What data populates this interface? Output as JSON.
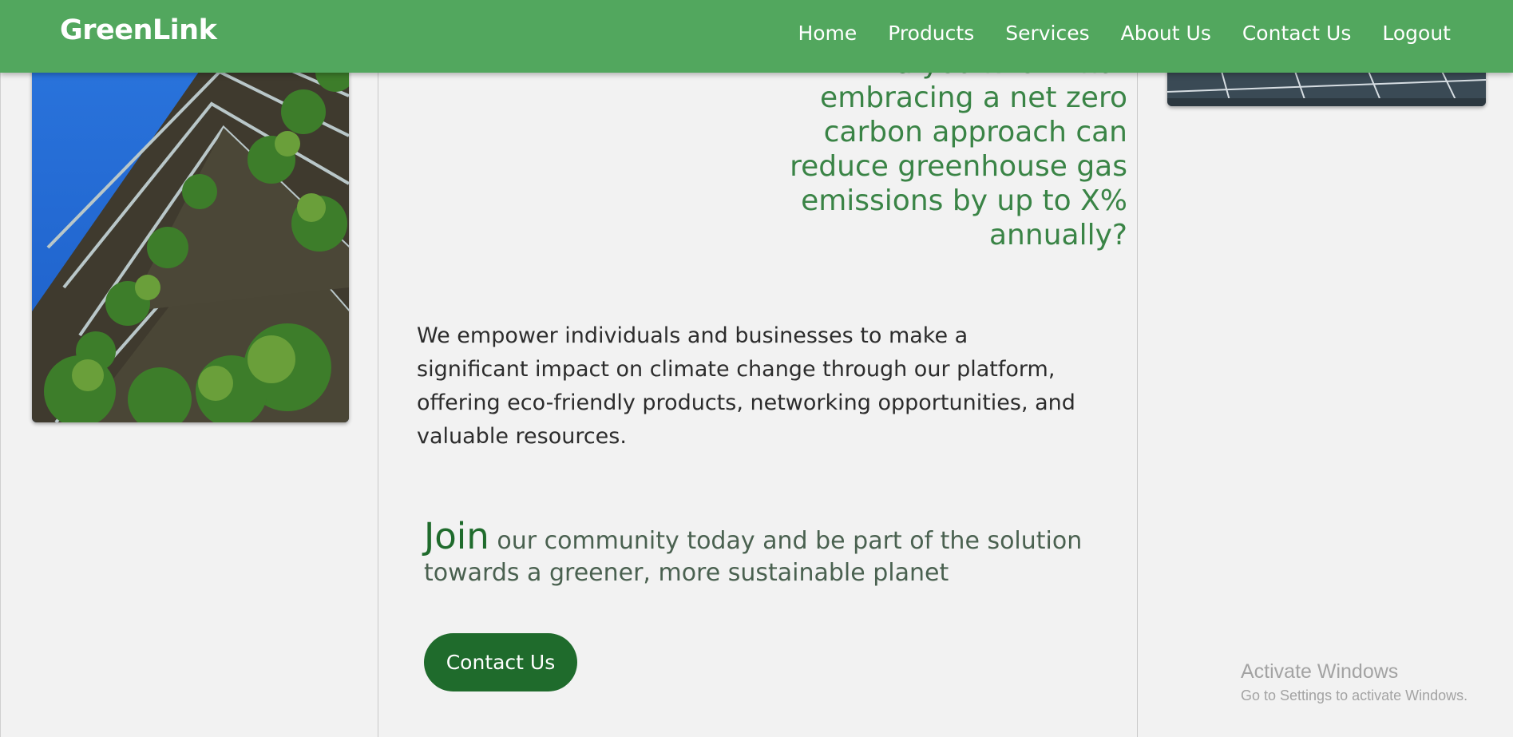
{
  "brand": "GreenLink",
  "nav": [
    "Home",
    "Products",
    "Services",
    "About Us",
    "Contact Us",
    "Logout"
  ],
  "fact_lines": [
    "Did you know that",
    "embracing a net zero",
    "carbon approach can",
    "reduce greenhouse gas",
    "emissions by up to X%",
    "annually?"
  ],
  "mission_lines": [
    "We empower individuals and businesses to make a",
    "significant impact on climate change through our platform,",
    "offering eco-friendly products, networking opportunities, and",
    "valuable resources."
  ],
  "join": {
    "highlight": "Join",
    "line1_rest": " our community today and be part of the solution",
    "line2": "towards a greener, more sustainable planet"
  },
  "cta_label": "Contact Us",
  "watermark": {
    "title": "Activate Windows",
    "subtitle": "Go to Settings to activate Windows."
  },
  "colors": {
    "navbar": "#52a75e",
    "accent_dark": "#1f6b2c",
    "fact_text": "#3a8446",
    "background": "#f2f2f2"
  },
  "images": {
    "left": "vertical-forest-building-photo",
    "right": "solar-panel-photo"
  }
}
